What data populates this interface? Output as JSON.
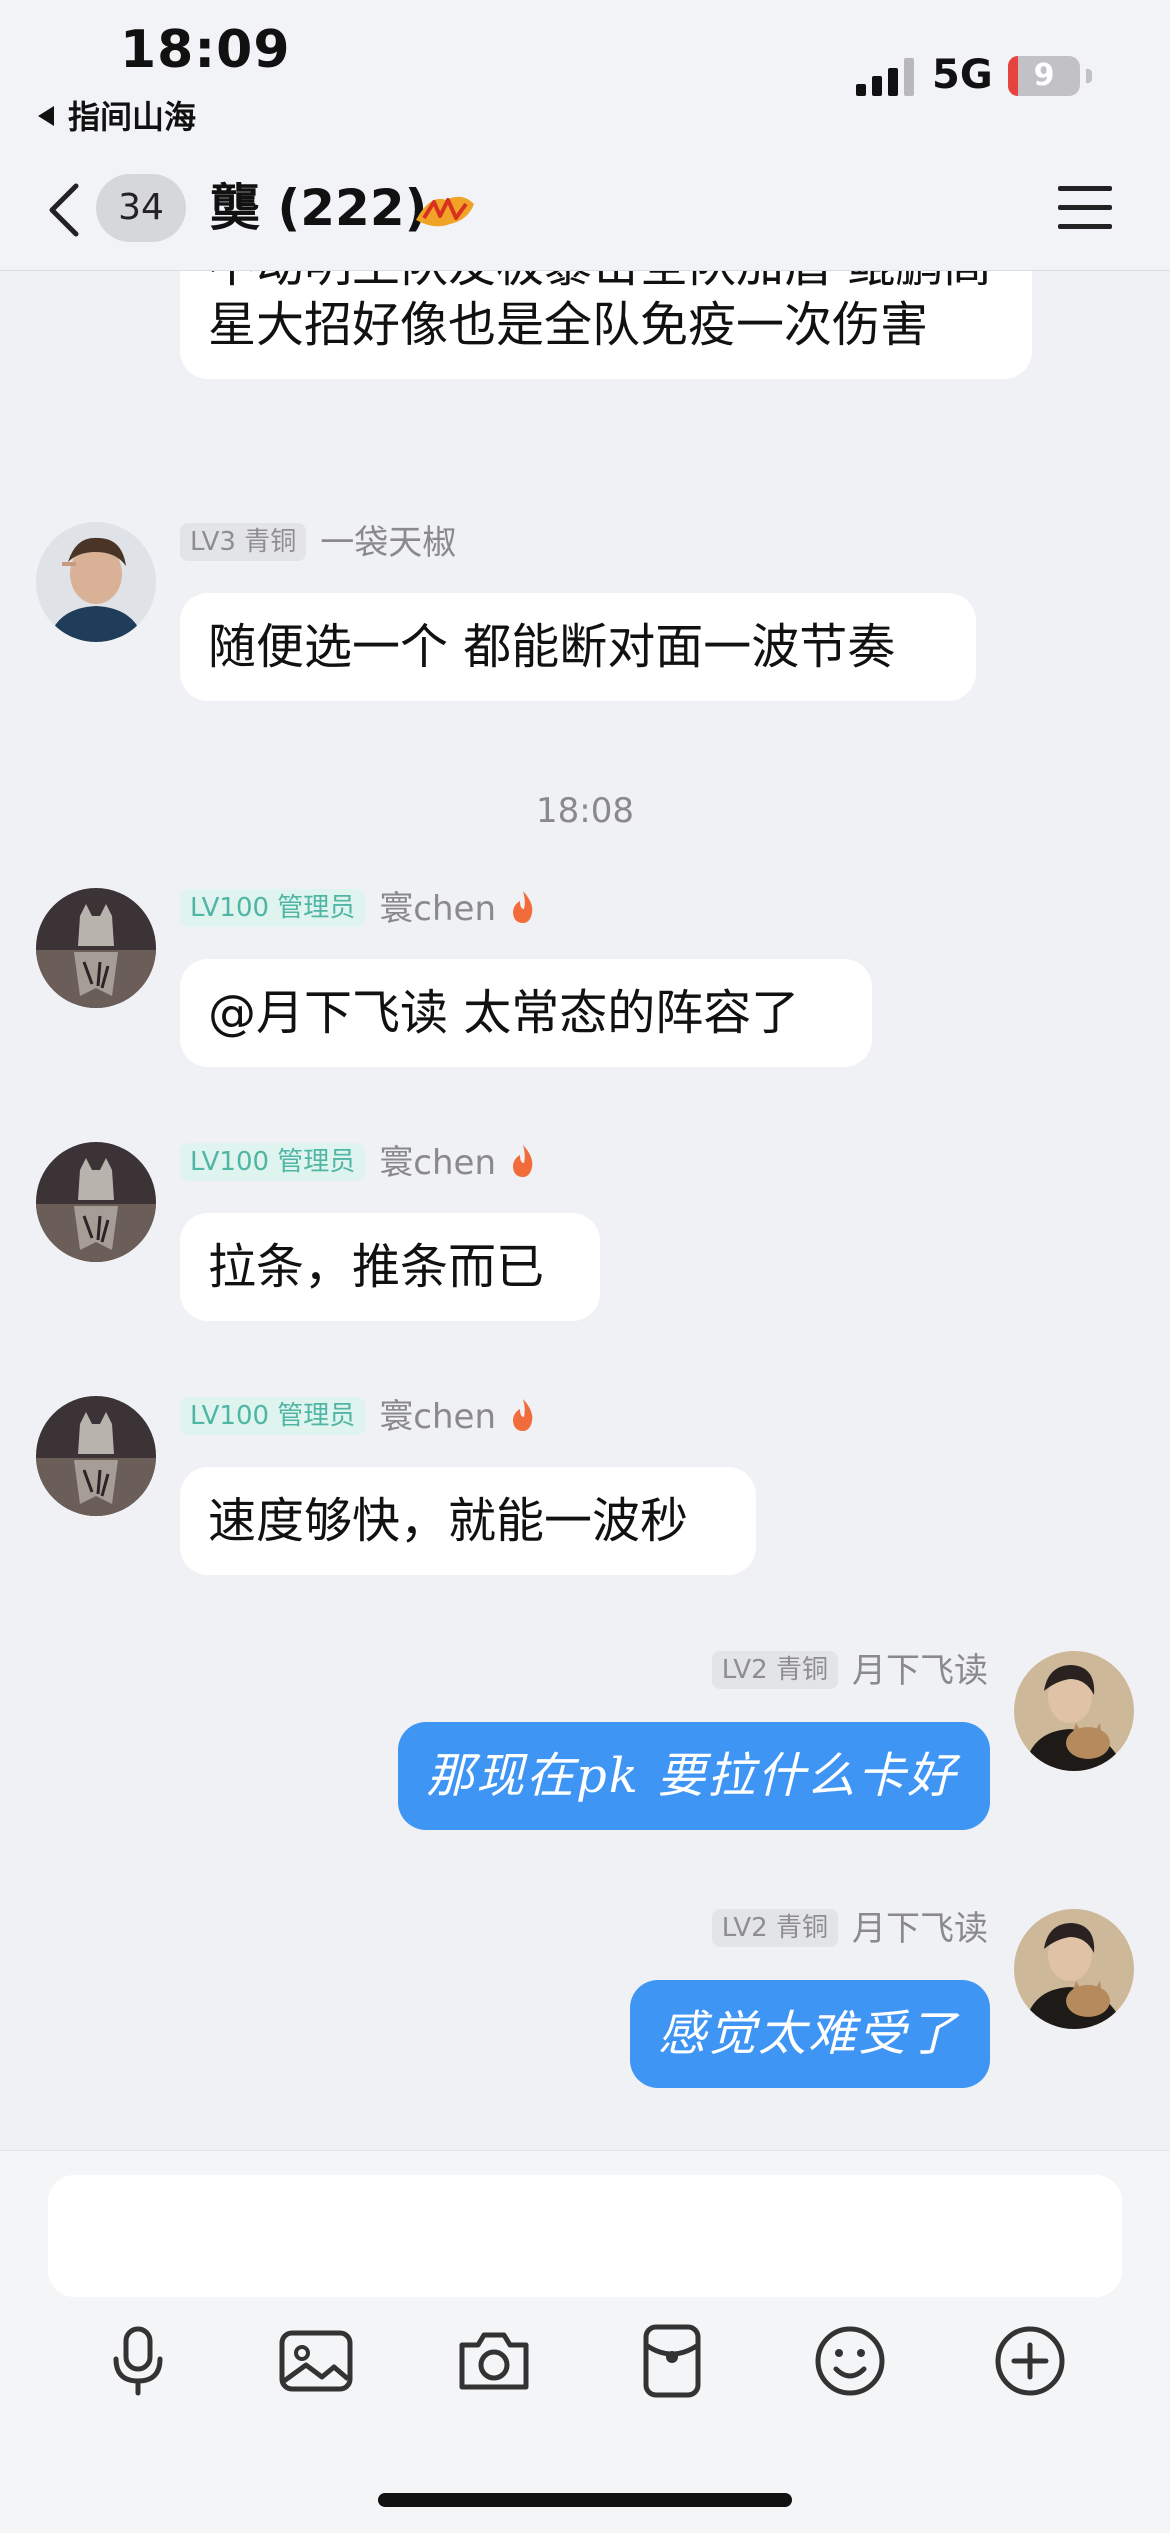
{
  "status_bar": {
    "time": "18:09",
    "back_app": "指间山海",
    "network": "5G",
    "battery": "9",
    "battery_level": 0.09
  },
  "header": {
    "unread_count": "34",
    "title": "龑 (222)"
  },
  "messages": [
    {
      "side": "left",
      "text": "不动明王队友极暴击全队加盾 鲲鹏高星大招好像也是全队免疫一次伤害"
    },
    {
      "side": "left",
      "level": "LV3 青铜",
      "name": "一袋天椒",
      "text": "随便选一个 都能断对面一波节奏"
    },
    {
      "side": "left",
      "level": "LV100 管理员",
      "name": "寰chen",
      "text": "@月下飞读 太常态的阵容了"
    },
    {
      "side": "left",
      "level": "LV100 管理员",
      "name": "寰chen",
      "text": "拉条，推条而已"
    },
    {
      "side": "left",
      "level": "LV100 管理员",
      "name": "寰chen",
      "text": "速度够快，就能一波秒"
    },
    {
      "side": "right",
      "level": "LV2 青铜",
      "name": "月下飞读",
      "text": "那现在pk 要拉什么卡好"
    },
    {
      "side": "right",
      "level": "LV2 青铜",
      "name": "月下飞读",
      "text": "感觉太难受了"
    }
  ],
  "timestamp": "18:08",
  "composer": {
    "tools": [
      "microphone-icon",
      "image-icon",
      "camera-icon",
      "red-packet-icon",
      "emoji-icon",
      "plus-icon"
    ]
  },
  "colors": {
    "accent_blue": "#3f95f4",
    "admin_green": "#4fb6a4",
    "background": "#f0f1f4"
  }
}
